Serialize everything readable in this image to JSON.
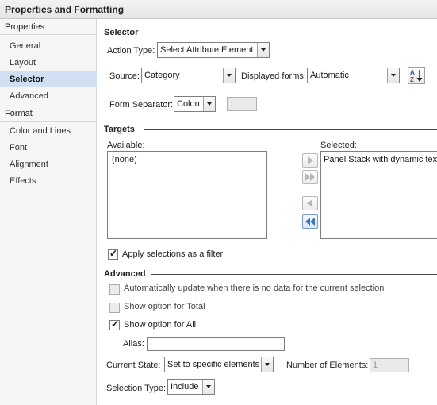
{
  "window": {
    "title": "Properties and Formatting"
  },
  "sidebar": {
    "categories": [
      {
        "label": "Properties",
        "items": [
          "General",
          "Layout",
          "Selector",
          "Advanced"
        ]
      },
      {
        "label": "Format",
        "items": [
          "Color and Lines",
          "Font",
          "Alignment",
          "Effects"
        ]
      }
    ],
    "selected": "Selector"
  },
  "selector": {
    "section_title": "Selector",
    "action_type_label": "Action Type:",
    "action_type_value": "Select Attribute Element",
    "source_label": "Source:",
    "source_value": "Category",
    "displayed_forms_label": "Displayed forms:",
    "displayed_forms_value": "Automatic",
    "sort_icon": "sort-az-icon",
    "form_separator_label": "Form Separator:",
    "form_separator_value": "Colon",
    "form_separator_text": ":"
  },
  "targets": {
    "section_title": "Targets",
    "available_label": "Available:",
    "available_items": [
      "(none)"
    ],
    "selected_label": "Selected:",
    "selected_items": [
      "Panel Stack with dynamic text"
    ],
    "apply_filter_label": "Apply selections as a filter",
    "apply_filter_checked": true
  },
  "advanced": {
    "section_title": "Advanced",
    "auto_update_label": "Automatically update when there is no data for the current selection",
    "auto_update_checked": false,
    "show_total_label": "Show option for Total",
    "show_total_checked": false,
    "show_all_label": "Show option for All",
    "show_all_checked": true,
    "alias_label": "Alias:",
    "alias_value": "",
    "current_state_label": "Current State:",
    "current_state_value": "Set to specific elements",
    "number_elements_label": "Number of Elements:",
    "number_elements_value": "1",
    "selection_type_label": "Selection Type:",
    "selection_type_value": "Include"
  },
  "colors": {
    "selected_bg": "#cfe0f3",
    "arrow_blue": "#3a76c4"
  }
}
